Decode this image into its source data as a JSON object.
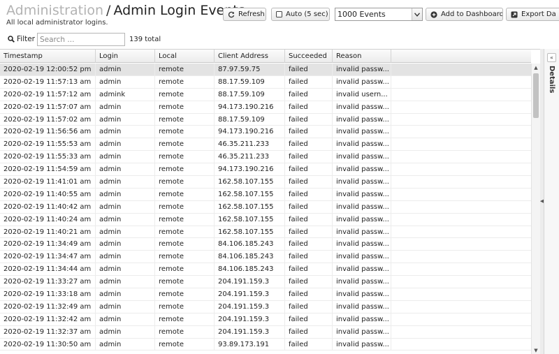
{
  "header": {
    "breadcrumb": "Administration",
    "separator": "/",
    "title": "Admin Login Events",
    "subtitle": "All local administrator logins."
  },
  "toolbar": {
    "refresh_label": "Refresh",
    "auto_label": "Auto (5 sec)",
    "auto_checked": false,
    "events_selected": "1000 Events",
    "add_dashboard_label": "Add to Dashboard",
    "export_label": "Export Da"
  },
  "filter": {
    "label": "Filter",
    "placeholder": "Search ...",
    "value": "",
    "total": "139 total"
  },
  "table": {
    "columns": [
      "Timestamp",
      "Login",
      "Local",
      "Client Address",
      "Succeeded",
      "Reason"
    ],
    "rows": [
      [
        "2020-02-19 12:00:52 pm",
        "admin",
        "remote",
        "87.97.59.75",
        "failed",
        "invalid passw..."
      ],
      [
        "2020-02-19 11:57:13 am",
        "admin",
        "remote",
        "88.17.59.109",
        "failed",
        "invalid passw..."
      ],
      [
        "2020-02-19 11:57:12 am",
        "admink",
        "remote",
        "88.17.59.109",
        "failed",
        "invalid usern..."
      ],
      [
        "2020-02-19 11:57:07 am",
        "admin",
        "remote",
        "94.173.190.216",
        "failed",
        "invalid passw..."
      ],
      [
        "2020-02-19 11:57:02 am",
        "admin",
        "remote",
        "88.17.59.109",
        "failed",
        "invalid passw..."
      ],
      [
        "2020-02-19 11:56:56 am",
        "admin",
        "remote",
        "94.173.190.216",
        "failed",
        "invalid passw..."
      ],
      [
        "2020-02-19 11:55:53 am",
        "admin",
        "remote",
        "46.35.211.233",
        "failed",
        "invalid passw..."
      ],
      [
        "2020-02-19 11:55:33 am",
        "admin",
        "remote",
        "46.35.211.233",
        "failed",
        "invalid passw..."
      ],
      [
        "2020-02-19 11:54:59 am",
        "admin",
        "remote",
        "94.173.190.216",
        "failed",
        "invalid passw..."
      ],
      [
        "2020-02-19 11:41:01 am",
        "admin",
        "remote",
        "162.58.107.155",
        "failed",
        "invalid passw..."
      ],
      [
        "2020-02-19 11:40:55 am",
        "admin",
        "remote",
        "162.58.107.155",
        "failed",
        "invalid passw..."
      ],
      [
        "2020-02-19 11:40:42 am",
        "admin",
        "remote",
        "162.58.107.155",
        "failed",
        "invalid passw..."
      ],
      [
        "2020-02-19 11:40:24 am",
        "admin",
        "remote",
        "162.58.107.155",
        "failed",
        "invalid passw..."
      ],
      [
        "2020-02-19 11:40:21 am",
        "admin",
        "remote",
        "162.58.107.155",
        "failed",
        "invalid passw..."
      ],
      [
        "2020-02-19 11:34:49 am",
        "admin",
        "remote",
        "84.106.185.243",
        "failed",
        "invalid passw..."
      ],
      [
        "2020-02-19 11:34:47 am",
        "admin",
        "remote",
        "84.106.185.243",
        "failed",
        "invalid passw..."
      ],
      [
        "2020-02-19 11:34:44 am",
        "admin",
        "remote",
        "84.106.185.243",
        "failed",
        "invalid passw..."
      ],
      [
        "2020-02-19 11:33:27 am",
        "admin",
        "remote",
        "204.191.159.3",
        "failed",
        "invalid passw..."
      ],
      [
        "2020-02-19 11:33:18 am",
        "admin",
        "remote",
        "204.191.159.3",
        "failed",
        "invalid passw..."
      ],
      [
        "2020-02-19 11:32:49 am",
        "admin",
        "remote",
        "204.191.159.3",
        "failed",
        "invalid passw..."
      ],
      [
        "2020-02-19 11:32:42 am",
        "admin",
        "remote",
        "204.191.159.3",
        "failed",
        "invalid passw..."
      ],
      [
        "2020-02-19 11:32:37 am",
        "admin",
        "remote",
        "204.191.159.3",
        "failed",
        "invalid passw..."
      ],
      [
        "2020-02-19 11:30:50 am",
        "admin",
        "remote",
        "93.89.173.191",
        "failed",
        "invalid passw..."
      ]
    ],
    "selected_row": 0
  },
  "details": {
    "label": "Details"
  },
  "colors": {
    "breadcrumb": "#b3b3b3",
    "selected_row": "#e3e3e3"
  }
}
